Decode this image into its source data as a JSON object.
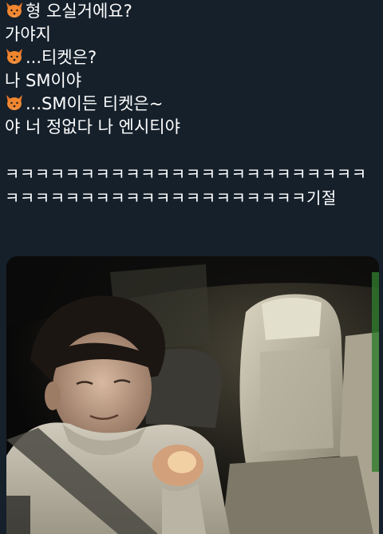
{
  "tweet": {
    "lines": [
      {
        "icon": "fox-emoji-icon",
        "text": "형 오실거에요?"
      },
      {
        "icon": null,
        "text": "가야지"
      },
      {
        "icon": "fox-emoji-icon",
        "text": "...티켓은?"
      },
      {
        "icon": null,
        "text": "나 SM이야"
      },
      {
        "icon": "fox-emoji-icon",
        "text": "...SM이든 티켓은~"
      },
      {
        "icon": null,
        "text": "야 너 정없다 나 엔시티야"
      }
    ],
    "laugh_line_1": "ㅋㅋㅋㅋㅋㅋㅋㅋㅋㅋㅋㅋㅋㅋㅋㅋㅋㅋㅋㅋㅋㅋㅋㅋ",
    "laugh_line_2": "ㅋㅋㅋㅋㅋㅋㅋㅋㅋㅋㅋㅋㅋㅋㅋㅋㅋㅋㅋㅋ기절"
  },
  "media": {
    "icon": "car-interior-photo"
  },
  "colors": {
    "background": "#15202b",
    "text": "#ffffff"
  }
}
